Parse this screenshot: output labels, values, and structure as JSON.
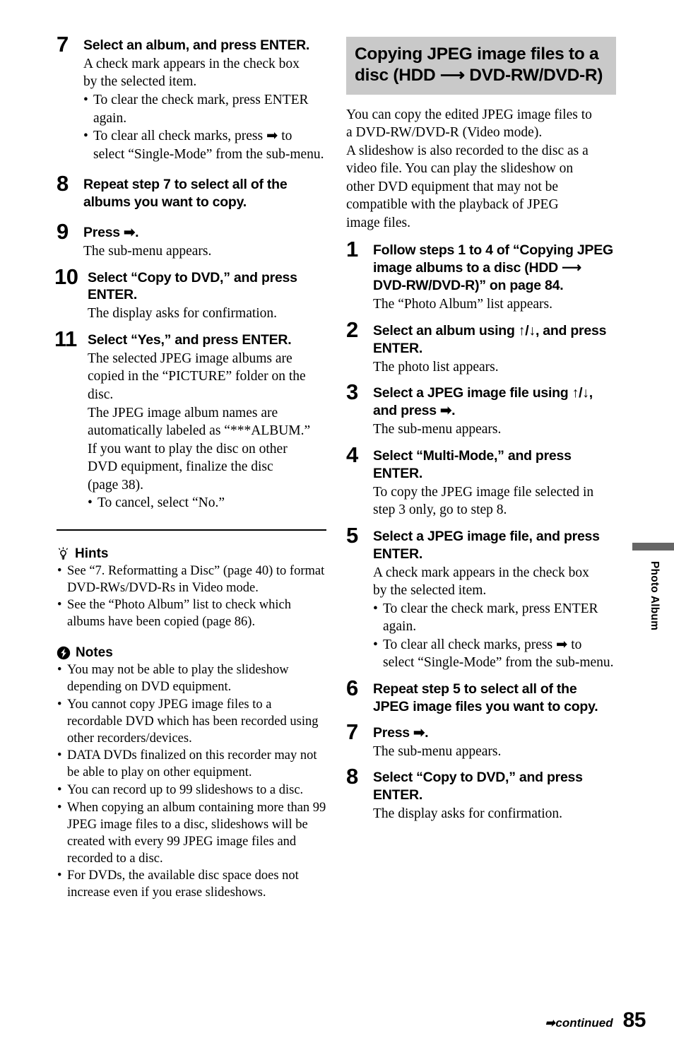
{
  "page": {
    "number": "85",
    "continued_label": "continued",
    "continued_arrow": "➡",
    "side_tab_label": "Photo Album"
  },
  "left_column": {
    "steps": [
      {
        "num": "7",
        "title": "Select an album, and press ENTER.",
        "body": [
          "A check mark appears in the check box",
          "by the selected item."
        ],
        "bullets": [
          "To clear the check mark, press ENTER again.",
          "To clear all check marks, press ➡ to select “Single-Mode” from the sub-menu."
        ]
      },
      {
        "num": "8",
        "title": "Repeat step 7 to select all of the albums you want to copy.",
        "body": [],
        "bullets": []
      },
      {
        "num": "9",
        "title": "Press ➡.",
        "body": [
          "The sub-menu appears."
        ],
        "bullets": []
      },
      {
        "num": "10",
        "title": "Select “Copy to DVD,” and press ENTER.",
        "body": [
          "The display asks for confirmation."
        ],
        "bullets": []
      },
      {
        "num": "11",
        "title": "Select “Yes,” and press ENTER.",
        "body": [
          "The selected JPEG image albums are",
          "copied in the “PICTURE” folder on the",
          "disc.",
          "The JPEG image album names are",
          "automatically labeled as “***ALBUM.”",
          "If you want to play the disc on other",
          "DVD equipment, finalize the disc",
          "(page 38)."
        ],
        "bullets": [
          "To cancel, select “No.”"
        ]
      }
    ],
    "hints": {
      "icon": "lightbulb-icon",
      "heading": "Hints",
      "items": [
        "See “7. Reformatting a Disc” (page 40) to format DVD-RWs/DVD-Rs in Video mode.",
        "See the “Photo Album” list to check which albums have been copied (page 86)."
      ]
    },
    "notes": {
      "icon": "note-warning-icon",
      "heading": "Notes",
      "items": [
        "You may not be able to play the slideshow depending on DVD equipment.",
        "You cannot copy JPEG image files to a recordable DVD which has been recorded using other recorders/devices.",
        "DATA DVDs finalized on this recorder may not be able to play on other equipment.",
        "You can record up to 99 slideshows to a disc.",
        "When copying an album containing more than 99 JPEG image files to a disc, slideshows will be created with every 99 JPEG image files and recorded to a disc.",
        "For DVDs, the available disc space does not increase even if you erase slideshows."
      ]
    }
  },
  "right_column": {
    "section_title": [
      "Copying JPEG image files to a",
      "disc (HDD ⟶ DVD-RW/DVD-R)"
    ],
    "intro": [
      "You can copy the edited JPEG image files to",
      "a DVD-RW/DVD-R (Video mode).",
      "A slideshow is also recorded to the disc as a",
      "video file. You can play the slideshow on",
      "other DVD equipment that may not be",
      "compatible with the playback of JPEG",
      "image files."
    ],
    "steps": [
      {
        "num": "1",
        "title": "Follow steps 1 to 4 of “Copying JPEG image albums to a disc (HDD ⟶ DVD-RW/DVD-R)” on page 84.",
        "title_lines": [
          "Follow steps 1 to 4 of “Copying JPEG",
          "image albums to a disc",
          "(HDD ⟶ DVD-RW/DVD-R)” on",
          "page 84."
        ],
        "body": [
          "The “Photo Album” list appears."
        ],
        "bullets": []
      },
      {
        "num": "2",
        "title": "Select an album using ↑/↓, and press ENTER.",
        "body": [
          "The photo list appears."
        ],
        "bullets": []
      },
      {
        "num": "3",
        "title": "Select a JPEG image file using ↑/↓, and press ➡.",
        "body": [
          "The sub-menu appears."
        ],
        "bullets": []
      },
      {
        "num": "4",
        "title": "Select “Multi-Mode,” and press ENTER.",
        "body": [
          "To copy the JPEG image file selected in",
          "step 3 only, go to step 8."
        ],
        "bullets": []
      },
      {
        "num": "5",
        "title": "Select a JPEG image file, and press ENTER.",
        "body": [
          "A check mark appears in the check box",
          "by the selected item."
        ],
        "bullets": [
          "To clear the check mark, press ENTER again.",
          "To clear all check marks, press ➡ to select “Single-Mode” from the sub-menu."
        ]
      },
      {
        "num": "6",
        "title": "Repeat step 5 to select all of the JPEG image files you want to copy.",
        "body": [],
        "bullets": []
      },
      {
        "num": "7",
        "title": "Press ➡.",
        "body": [
          "The sub-menu appears."
        ],
        "bullets": []
      },
      {
        "num": "8",
        "title": "Select “Copy to DVD,” and press ENTER.",
        "body": [
          "The display asks for confirmation."
        ],
        "bullets": []
      }
    ]
  }
}
